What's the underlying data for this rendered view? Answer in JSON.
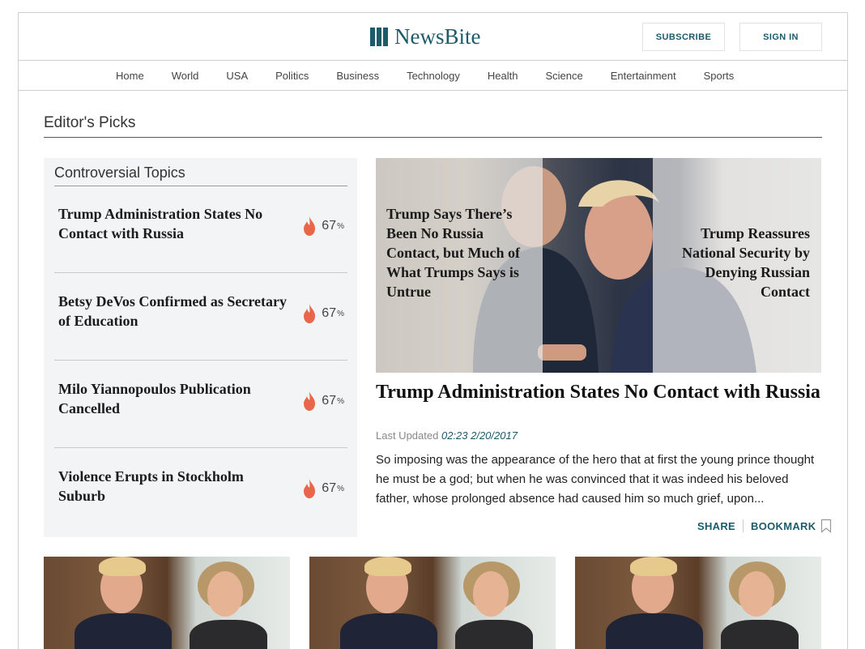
{
  "header": {
    "logo_text": "NewsBite",
    "subscribe_label": "SUBSCRIBE",
    "signin_label": "SIGN IN"
  },
  "nav": {
    "items": [
      "Home",
      "World",
      "USA",
      "Politics",
      "Business",
      "Technology",
      "Health",
      "Science",
      "Entertainment",
      "Sports"
    ]
  },
  "section": {
    "title": "Editor's Picks"
  },
  "controversial": {
    "title": "Controversial Topics",
    "items": [
      {
        "title": "Trump Administration States No Contact with Russia",
        "percent": "67",
        "percent_sign": "%"
      },
      {
        "title": "Betsy DeVos Confirmed as Secretary of Education",
        "percent": "67",
        "percent_sign": "%"
      },
      {
        "title": "Milo Yiannopoulos Publication Cancelled",
        "percent": "67",
        "percent_sign": "%"
      },
      {
        "title": "Violence Erupts in Stockholm Suburb",
        "percent": "67",
        "percent_sign": "%"
      }
    ]
  },
  "feature": {
    "left_overlay": "Trump Says There’s Been No Russia Contact, but Much of What Trumps Says is Untrue",
    "right_overlay": "Trump Reassures National Security by Denying Russian Contact",
    "headline": "Trump Administration States No Contact with Russia",
    "updated_label": "Last Updated",
    "updated_time": "02:23 2/20/2017",
    "summary": "So imposing was the appearance of the hero that at first the young prince thought he must be a god; but when he was convinced that it was indeed his beloved father, whose prolonged absence had caused him so much grief, upon...",
    "share_label": "SHARE",
    "bookmark_label": "BOOKMARK"
  },
  "colors": {
    "brand": "#1d5a6a",
    "flame": "#e8674a",
    "panel_bg": "#f3f4f6"
  }
}
